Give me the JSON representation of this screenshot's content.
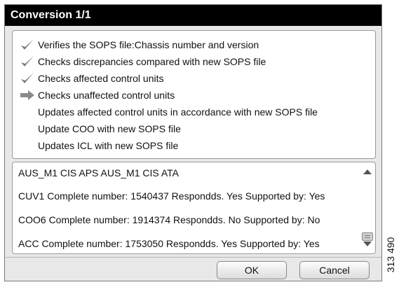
{
  "dialog": {
    "title": "Conversion 1/1"
  },
  "steps": [
    {
      "label": "Verifies the SOPS file:Chassis number and version",
      "status": "done",
      "icon": "check-icon"
    },
    {
      "label": "Checks discrepancies compared with new SOPS file",
      "status": "done",
      "icon": "check-icon"
    },
    {
      "label": "Checks affected control units",
      "status": "done",
      "icon": "check-icon"
    },
    {
      "label": "Checks unaffected control units",
      "status": "in-progress",
      "icon": "arrow-right-icon"
    },
    {
      "label": "Updates affected control units in accordance with new SOPS file",
      "status": "pending",
      "icon": ""
    },
    {
      "label": "Update COO with new SOPS file",
      "status": "pending",
      "icon": ""
    },
    {
      "label": "Updates ICL with new SOPS file",
      "status": "pending",
      "icon": ""
    }
  ],
  "log": {
    "lines": [
      "AUS_M1 CIS APS AUS_M1 CIS ATA",
      "CUV1 Complete number: 1540437 Respondds. Yes Supported by: Yes",
      "COO6 Complete number: 1914374 Respondds. No Supported by: No",
      "ACC Complete number: 1753050 Respondds. Yes Supported by: Yes"
    ]
  },
  "buttons": {
    "ok": "OK",
    "cancel": "Cancel"
  },
  "side_code": "313 490",
  "colors": {
    "titlebar": "#000000",
    "check": "#7a7a7a",
    "arrow": "#8a8a8a"
  }
}
